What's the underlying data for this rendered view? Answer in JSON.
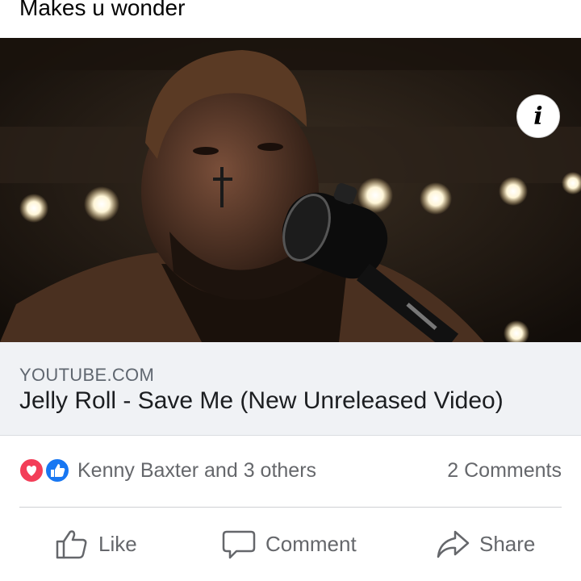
{
  "post": {
    "text": "Makes u wonder"
  },
  "media": {
    "image": "video-thumbnail-singer-at-microphone",
    "info_icon": "info-icon"
  },
  "link": {
    "domain": "YOUTUBE.COM",
    "title": "Jelly Roll - Save Me (New Unreleased Video)"
  },
  "reactions": {
    "icons": [
      "love-reaction-icon",
      "like-reaction-icon"
    ],
    "names": "Kenny Baxter and 3 others",
    "comments": "2 Comments"
  },
  "actions": {
    "like_label": "Like",
    "comment_label": "Comment",
    "share_label": "Share"
  },
  "colors": {
    "love": "#f33e58",
    "like": "#1877f2",
    "secondary_text": "#65676b",
    "link_bg": "#f0f2f5"
  }
}
